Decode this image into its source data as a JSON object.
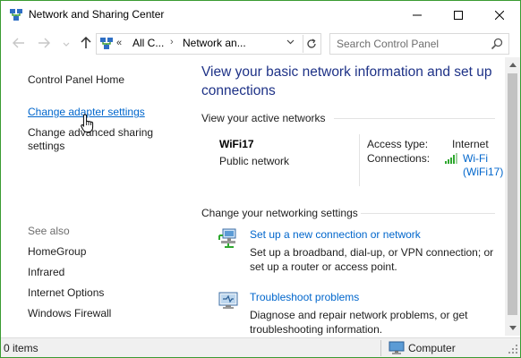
{
  "window": {
    "title": "Network and Sharing Center",
    "controls": {
      "minimize": "—",
      "maximize": "☐",
      "close": "✕"
    }
  },
  "address": {
    "overflow": "«",
    "crumb1": "All C...",
    "separator": "›",
    "crumb2": "Network an...",
    "search_placeholder": "Search Control Panel"
  },
  "left_pane": {
    "home": "Control Panel Home",
    "adapter": "Change adapter settings",
    "sharing": "Change advanced sharing settings",
    "see_also": "See also",
    "see_also_items": [
      "HomeGroup",
      "Infrared",
      "Internet Options",
      "Windows Firewall"
    ]
  },
  "main": {
    "title": "View your basic network information and set up connections",
    "active_heading": "View your active networks",
    "network": {
      "name": "WiFi17",
      "category": "Public network",
      "access_label": "Access type:",
      "access_value": "Internet",
      "connections_label": "Connections:",
      "connections_value_line1": "Wi-Fi",
      "connections_value_line2": "(WiFi17)"
    },
    "change_heading": "Change your networking settings",
    "tasks": [
      {
        "icon": "network-setup-icon",
        "link": "Set up a new connection or network",
        "desc": "Set up a broadband, dial-up, or VPN connection; or set up a router or access point."
      },
      {
        "icon": "troubleshoot-icon",
        "link": "Troubleshoot problems",
        "desc": "Diagnose and repair network problems, or get troubleshooting information."
      }
    ]
  },
  "status": {
    "items": "0 items",
    "location": "Computer"
  },
  "colors": {
    "title_blue": "#1e3287",
    "link_blue": "#0066cc",
    "window_border": "#3a9b32"
  }
}
